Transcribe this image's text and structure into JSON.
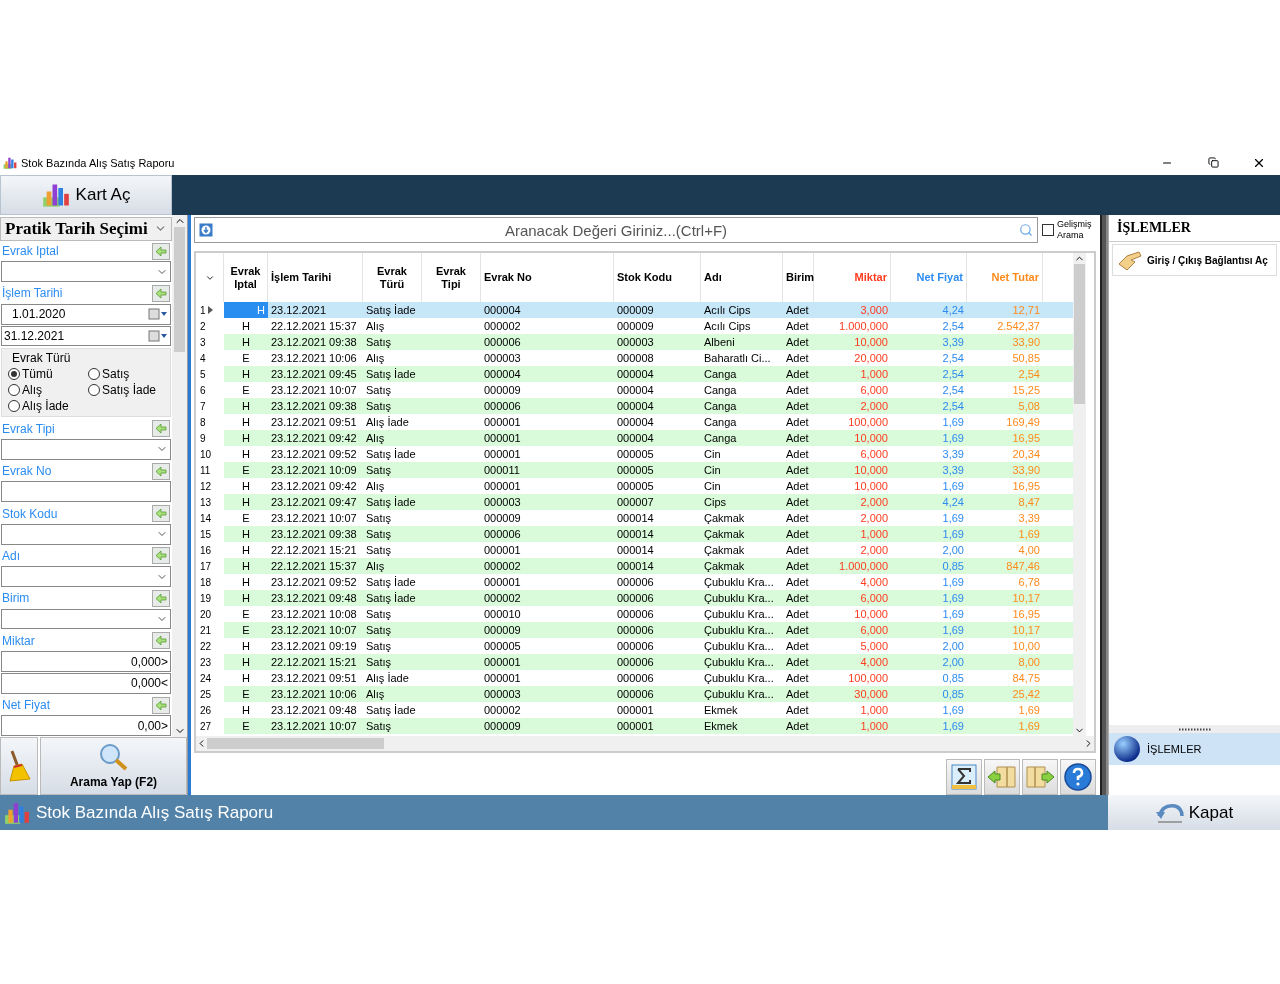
{
  "window": {
    "title": "Stok Bazında Alış Satış Raporu"
  },
  "toolbar": {
    "open_card_button": "Kart Aç"
  },
  "filter_panel": {
    "title": "Pratik Tarih Seçimi",
    "filters": [
      {
        "kind": "field",
        "label": "Evrak Iptal",
        "inputs": [
          {
            "kind": "combo"
          }
        ]
      },
      {
        "kind": "field",
        "label": "İşlem Tarihi",
        "inputs": [
          {
            "kind": "date",
            "value": "1.01.2020",
            "indent": true
          },
          {
            "kind": "date",
            "value": "31.12.2021"
          }
        ]
      },
      {
        "kind": "radio_group",
        "legend": "Evrak Türü",
        "options": [
          {
            "label": "Tümü",
            "selected": true
          },
          {
            "label": "Satış",
            "selected": false
          },
          {
            "label": "Alış",
            "selected": false
          },
          {
            "label": "Satış İade",
            "selected": false
          },
          {
            "label": "Alış İade",
            "selected": false
          }
        ]
      },
      {
        "kind": "field",
        "label": "Evrak Tipi",
        "inputs": [
          {
            "kind": "combo"
          }
        ]
      },
      {
        "kind": "field",
        "label": "Evrak No",
        "inputs": [
          {
            "kind": "text"
          }
        ]
      },
      {
        "kind": "field",
        "label": "Stok Kodu",
        "inputs": [
          {
            "kind": "combo"
          }
        ]
      },
      {
        "kind": "field",
        "label": "Adı",
        "inputs": [
          {
            "kind": "combo"
          }
        ]
      },
      {
        "kind": "field",
        "label": "Birim",
        "inputs": [
          {
            "kind": "combo"
          }
        ]
      },
      {
        "kind": "field",
        "label": "Miktar",
        "inputs": [
          {
            "kind": "number",
            "value": "0,000>"
          },
          {
            "kind": "number",
            "value": "0,000<"
          }
        ]
      },
      {
        "kind": "field",
        "label": "Net Fiyat",
        "inputs": [
          {
            "kind": "number",
            "value": "0,00>"
          }
        ]
      }
    ],
    "search_button": "Arama Yap (F2)"
  },
  "search": {
    "placeholder": "Aranacak Değeri Giriniz...(Ctrl+F)",
    "advanced": {
      "label": "Gelişmiş Arama",
      "checked": false
    }
  },
  "table": {
    "columns": [
      {
        "label": "Evrak Iptal",
        "kind": "flag"
      },
      {
        "label": "İşlem Tarihi",
        "kind": "text"
      },
      {
        "label": "Evrak Türü",
        "kind": "text"
      },
      {
        "label": "Evrak Tipi",
        "kind": "text"
      },
      {
        "label": "Evrak No",
        "kind": "text"
      },
      {
        "label": "Stok Kodu",
        "kind": "text"
      },
      {
        "label": "Adı",
        "kind": "text"
      },
      {
        "label": "Birim",
        "kind": "text"
      },
      {
        "label": "Miktar",
        "kind": "number",
        "color": "#ff3b1f"
      },
      {
        "label": "Net Fiyat",
        "kind": "number",
        "color": "#2d8cf0"
      },
      {
        "label": "Net Tutar",
        "kind": "number",
        "color": "#ff8a1c"
      }
    ],
    "rows": [
      {
        "number": "1",
        "selected": true,
        "cells": [
          "H",
          "23.12.2021",
          "Satış İade",
          "",
          "000004",
          "000009",
          "Acılı Cips",
          "Adet",
          "3,000",
          "4,24",
          "12,71"
        ]
      },
      {
        "number": "2",
        "selected": false,
        "cells": [
          "H",
          "22.12.2021 15:37",
          "Alış",
          "",
          "000002",
          "000009",
          "Acılı Cips",
          "Adet",
          "1.000,000",
          "2,54",
          "2.542,37"
        ]
      },
      {
        "number": "3",
        "selected": false,
        "cells": [
          "H",
          "23.12.2021 09:38",
          "Satış",
          "",
          "000006",
          "000003",
          "Albeni",
          "Adet",
          "10,000",
          "3,39",
          "33,90"
        ]
      },
      {
        "number": "4",
        "selected": false,
        "cells": [
          "E",
          "23.12.2021 10:06",
          "Alış",
          "",
          "000003",
          "000008",
          "Baharatlı Ci...",
          "Adet",
          "20,000",
          "2,54",
          "50,85"
        ]
      },
      {
        "number": "5",
        "selected": false,
        "cells": [
          "H",
          "23.12.2021 09:45",
          "Satış İade",
          "",
          "000004",
          "000004",
          "Canga",
          "Adet",
          "1,000",
          "2,54",
          "2,54"
        ]
      },
      {
        "number": "6",
        "selected": false,
        "cells": [
          "E",
          "23.12.2021 10:07",
          "Satış",
          "",
          "000009",
          "000004",
          "Canga",
          "Adet",
          "6,000",
          "2,54",
          "15,25"
        ]
      },
      {
        "number": "7",
        "selected": false,
        "cells": [
          "H",
          "23.12.2021 09:38",
          "Satış",
          "",
          "000006",
          "000004",
          "Canga",
          "Adet",
          "2,000",
          "2,54",
          "5,08"
        ]
      },
      {
        "number": "8",
        "selected": false,
        "cells": [
          "H",
          "23.12.2021 09:51",
          "Alış İade",
          "",
          "000001",
          "000004",
          "Canga",
          "Adet",
          "100,000",
          "1,69",
          "169,49"
        ]
      },
      {
        "number": "9",
        "selected": false,
        "cells": [
          "H",
          "23.12.2021 09:42",
          "Alış",
          "",
          "000001",
          "000004",
          "Canga",
          "Adet",
          "10,000",
          "1,69",
          "16,95"
        ]
      },
      {
        "number": "10",
        "selected": false,
        "cells": [
          "H",
          "23.12.2021 09:52",
          "Satış İade",
          "",
          "000001",
          "000005",
          "Cin",
          "Adet",
          "6,000",
          "3,39",
          "20,34"
        ]
      },
      {
        "number": "11",
        "selected": false,
        "cells": [
          "E",
          "23.12.2021 10:09",
          "Satış",
          "",
          "000011",
          "000005",
          "Cin",
          "Adet",
          "10,000",
          "3,39",
          "33,90"
        ]
      },
      {
        "number": "12",
        "selected": false,
        "cells": [
          "H",
          "23.12.2021 09:42",
          "Alış",
          "",
          "000001",
          "000005",
          "Cin",
          "Adet",
          "10,000",
          "1,69",
          "16,95"
        ]
      },
      {
        "number": "13",
        "selected": false,
        "cells": [
          "H",
          "23.12.2021 09:47",
          "Satış İade",
          "",
          "000003",
          "000007",
          "Cips",
          "Adet",
          "2,000",
          "4,24",
          "8,47"
        ]
      },
      {
        "number": "14",
        "selected": false,
        "cells": [
          "E",
          "23.12.2021 10:07",
          "Satış",
          "",
          "000009",
          "000014",
          "Çakmak",
          "Adet",
          "2,000",
          "1,69",
          "3,39"
        ]
      },
      {
        "number": "15",
        "selected": false,
        "cells": [
          "H",
          "23.12.2021 09:38",
          "Satış",
          "",
          "000006",
          "000014",
          "Çakmak",
          "Adet",
          "1,000",
          "1,69",
          "1,69"
        ]
      },
      {
        "number": "16",
        "selected": false,
        "cells": [
          "H",
          "22.12.2021 15:21",
          "Satış",
          "",
          "000001",
          "000014",
          "Çakmak",
          "Adet",
          "2,000",
          "2,00",
          "4,00"
        ]
      },
      {
        "number": "17",
        "selected": false,
        "cells": [
          "H",
          "22.12.2021 15:37",
          "Alış",
          "",
          "000002",
          "000014",
          "Çakmak",
          "Adet",
          "1.000,000",
          "0,85",
          "847,46"
        ]
      },
      {
        "number": "18",
        "selected": false,
        "cells": [
          "H",
          "23.12.2021 09:52",
          "Satış İade",
          "",
          "000001",
          "000006",
          "Çubuklu Kra...",
          "Adet",
          "4,000",
          "1,69",
          "6,78"
        ]
      },
      {
        "number": "19",
        "selected": false,
        "cells": [
          "H",
          "23.12.2021 09:48",
          "Satış İade",
          "",
          "000002",
          "000006",
          "Çubuklu Kra...",
          "Adet",
          "6,000",
          "1,69",
          "10,17"
        ]
      },
      {
        "number": "20",
        "selected": false,
        "cells": [
          "E",
          "23.12.2021 10:08",
          "Satış",
          "",
          "000010",
          "000006",
          "Çubuklu Kra...",
          "Adet",
          "10,000",
          "1,69",
          "16,95"
        ]
      },
      {
        "number": "21",
        "selected": false,
        "cells": [
          "E",
          "23.12.2021 10:07",
          "Satış",
          "",
          "000009",
          "000006",
          "Çubuklu Kra...",
          "Adet",
          "6,000",
          "1,69",
          "10,17"
        ]
      },
      {
        "number": "22",
        "selected": false,
        "cells": [
          "H",
          "23.12.2021 09:19",
          "Satış",
          "",
          "000005",
          "000006",
          "Çubuklu Kra...",
          "Adet",
          "5,000",
          "2,00",
          "10,00"
        ]
      },
      {
        "number": "23",
        "selected": false,
        "cells": [
          "H",
          "22.12.2021 15:21",
          "Satış",
          "",
          "000001",
          "000006",
          "Çubuklu Kra...",
          "Adet",
          "4,000",
          "2,00",
          "8,00"
        ]
      },
      {
        "number": "24",
        "selected": false,
        "cells": [
          "H",
          "23.12.2021 09:51",
          "Alış İade",
          "",
          "000001",
          "000006",
          "Çubuklu Kra...",
          "Adet",
          "100,000",
          "0,85",
          "84,75"
        ]
      },
      {
        "number": "25",
        "selected": false,
        "cells": [
          "E",
          "23.12.2021 10:06",
          "Alış",
          "",
          "000003",
          "000006",
          "Çubuklu Kra...",
          "Adet",
          "30,000",
          "0,85",
          "25,42"
        ]
      },
      {
        "number": "26",
        "selected": false,
        "cells": [
          "H",
          "23.12.2021 09:48",
          "Satış İade",
          "",
          "000002",
          "000001",
          "Ekmek",
          "Adet",
          "1,000",
          "1,69",
          "1,69"
        ]
      },
      {
        "number": "27",
        "selected": false,
        "cells": [
          "E",
          "23.12.2021 10:07",
          "Satış",
          "",
          "000009",
          "000001",
          "Ekmek",
          "Adet",
          "1,000",
          "1,69",
          "1,69"
        ]
      }
    ]
  },
  "actions_panel": {
    "title": "İŞLEMLER",
    "actions": [
      "Giriş / Çıkış Bağlantısı Aç"
    ],
    "groups": [
      {
        "label": "İŞLEMLER",
        "selected": true
      }
    ]
  },
  "status_bar": {
    "title": "Stok Bazında Alış Satış Raporu",
    "close_button": "Kapat"
  }
}
